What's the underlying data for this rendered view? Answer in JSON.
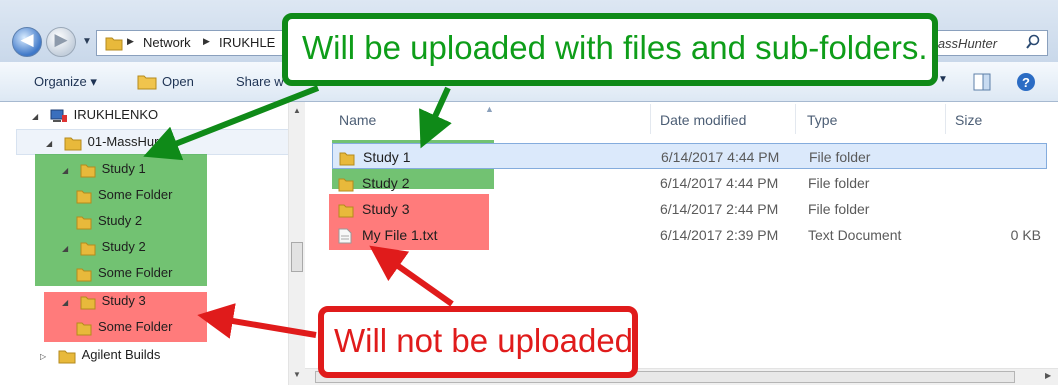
{
  "window": {
    "breadcrumb": [
      "Network",
      "IRUKHLE"
    ],
    "search_tail": "MassHunter"
  },
  "toolbar": {
    "organize_label": "Organize ▾",
    "open_label": "Open",
    "share_label": "Share w"
  },
  "nav": {
    "root": "IRUKHLENKO",
    "items": [
      {
        "label": "01-MassHur"
      },
      {
        "label": "Study 1"
      },
      {
        "label": "Some Folder"
      },
      {
        "label": "Study 2"
      },
      {
        "label": "Study 2"
      },
      {
        "label": "Some Folder"
      },
      {
        "label": "Study 3"
      },
      {
        "label": "Some Folder"
      },
      {
        "label": "Agilent Builds"
      }
    ]
  },
  "content": {
    "columns": {
      "name": "Name",
      "date": "Date modified",
      "type": "Type",
      "size": "Size"
    },
    "files": [
      {
        "name": "Study 1",
        "date": "6/14/2017 4:44 PM",
        "type": "File folder",
        "size": ""
      },
      {
        "name": "Study 2",
        "date": "6/14/2017 4:44 PM",
        "type": "File folder",
        "size": ""
      },
      {
        "name": "Study 3",
        "date": "6/14/2017 2:44 PM",
        "type": "File folder",
        "size": ""
      },
      {
        "name": "My File 1.txt",
        "date": "6/14/2017 2:39 PM",
        "type": "Text Document",
        "size": "0 KB"
      }
    ]
  },
  "callouts": {
    "green": "Will be uploaded with files and sub-folders.",
    "red": "Will not be uploaded"
  },
  "colors": {
    "green": "#0f8a18",
    "red": "#e01b1b",
    "highlight_green": "rgba(60,170,60,0.72)",
    "highlight_red": "rgba(255,100,100,0.85)"
  },
  "icons": [
    "back-icon",
    "forward-icon",
    "folder-icon",
    "search-icon",
    "pane-icon",
    "help-icon",
    "network-computer-icon",
    "text-file-icon"
  ]
}
